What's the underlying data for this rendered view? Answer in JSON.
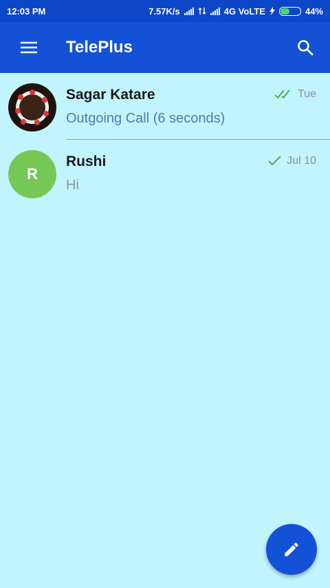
{
  "status_bar": {
    "time": "12:03 PM",
    "speed": "7.57K/s",
    "network": "4G VoLTE",
    "battery": "44%",
    "battery_level": 0.44
  },
  "app_bar": {
    "title": "TelePlus",
    "menu_icon": "menu-icon",
    "search_icon": "search-icon"
  },
  "chats": [
    {
      "name": "Sagar Katare",
      "preview": "Outgoing Call (6 seconds)",
      "date": "Tue",
      "status": "read-double-check",
      "avatar": "photo"
    },
    {
      "name": "Rushi",
      "preview": "Hi",
      "date": "Jul 10",
      "status": "sent-single-check",
      "avatar_letter": "R",
      "avatar_color": "#75c855"
    }
  ],
  "fab": {
    "icon": "pencil-icon"
  },
  "colors": {
    "primary": "#1352d6",
    "background": "#c2f4fd",
    "check": "#4caf50"
  }
}
